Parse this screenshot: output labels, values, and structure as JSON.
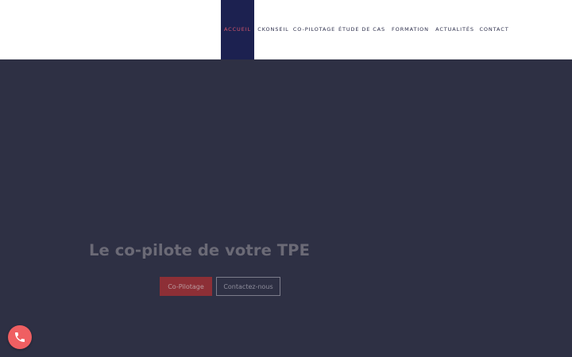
{
  "nav": {
    "items": [
      {
        "label": "ACCUEIL",
        "active": true
      },
      {
        "label": "CKONSEIL",
        "active": false
      },
      {
        "label": "CO-PILOTAGE",
        "active": false
      },
      {
        "label": "ÉTUDE DE CAS",
        "active": false
      },
      {
        "label": "FORMATION",
        "active": false
      },
      {
        "label": "ACTUALITÉS",
        "active": false
      },
      {
        "label": "CONTACT",
        "active": false
      }
    ]
  },
  "hero": {
    "title": "Le co-pilote de votre TPE",
    "primary_button": "Co-Pilotage",
    "secondary_button": "Contactez-nous"
  },
  "fab": {
    "icon": "phone-icon"
  },
  "colors": {
    "header_bg": "#ffffff",
    "nav_active_bg": "#1c2150",
    "nav_active_text": "#d4556b",
    "hero_bg": "#2e3044",
    "primary_button_bg": "#8d2f36",
    "fab_bg": "#ef5f62"
  }
}
